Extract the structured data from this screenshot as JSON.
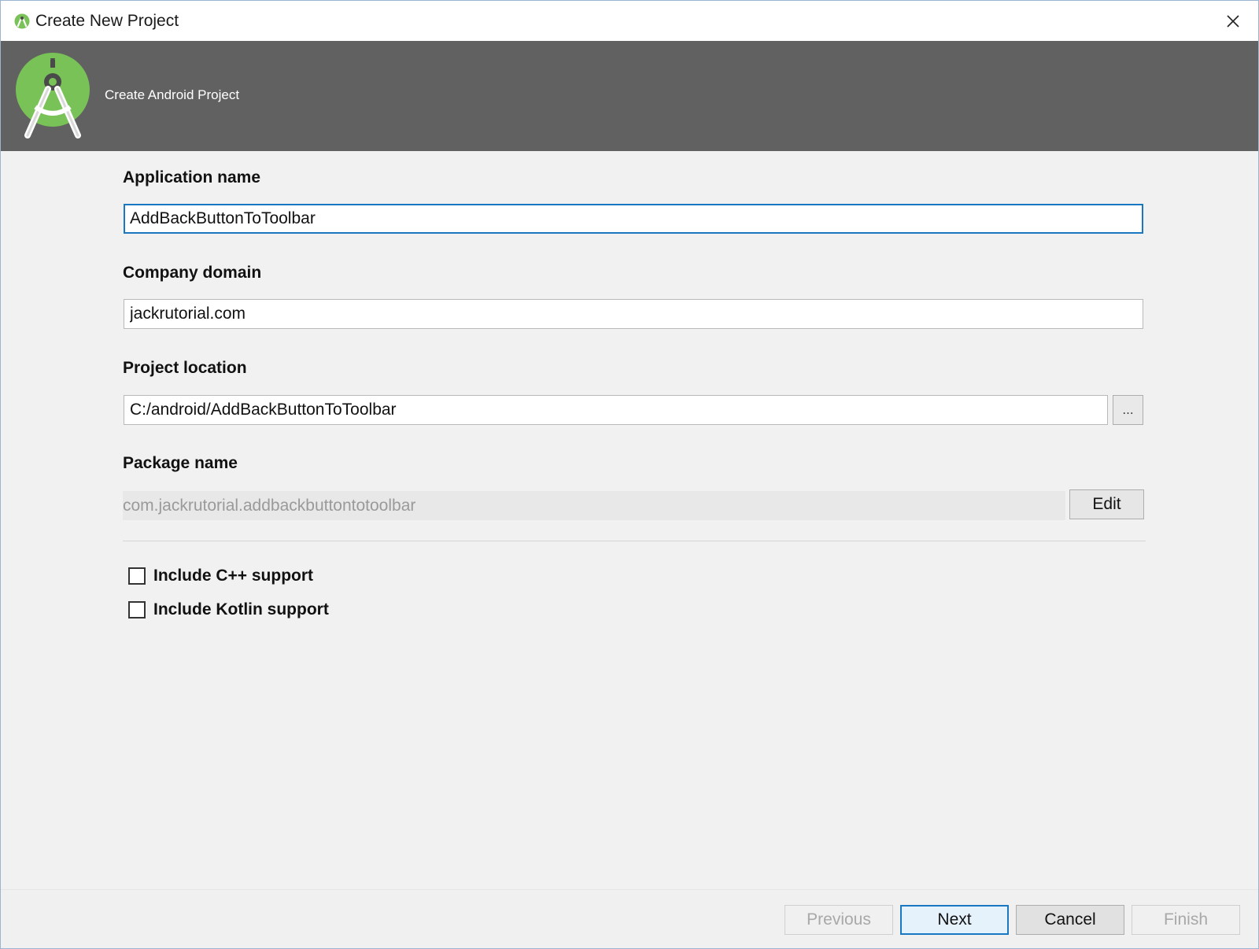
{
  "window": {
    "title": "Create New Project"
  },
  "banner": {
    "subtitle": "Create Android Project"
  },
  "form": {
    "application_name": {
      "label": "Application name",
      "value": "AddBackButtonToToolbar"
    },
    "company_domain": {
      "label": "Company domain",
      "value": "jackrutorial.com"
    },
    "project_location": {
      "label": "Project location",
      "value": "C:/android/AddBackButtonToToolbar",
      "browse_label": "..."
    },
    "package_name": {
      "label": "Package name",
      "value": "com.jackrutorial.addbackbuttontotoolbar",
      "edit_label": "Edit"
    },
    "options": [
      {
        "label": "Include C++ support",
        "checked": false
      },
      {
        "label": "Include Kotlin support",
        "checked": false
      }
    ]
  },
  "footer": {
    "previous_label": "Previous",
    "next_label": "Next",
    "cancel_label": "Cancel",
    "finish_label": "Finish"
  },
  "colors": {
    "banner_bg": "#616161",
    "accent": "#1a78c2",
    "android_green": "#78c257"
  },
  "icons": {
    "app": "android-studio-icon",
    "close": "close-icon",
    "logo": "android-studio-logo"
  }
}
